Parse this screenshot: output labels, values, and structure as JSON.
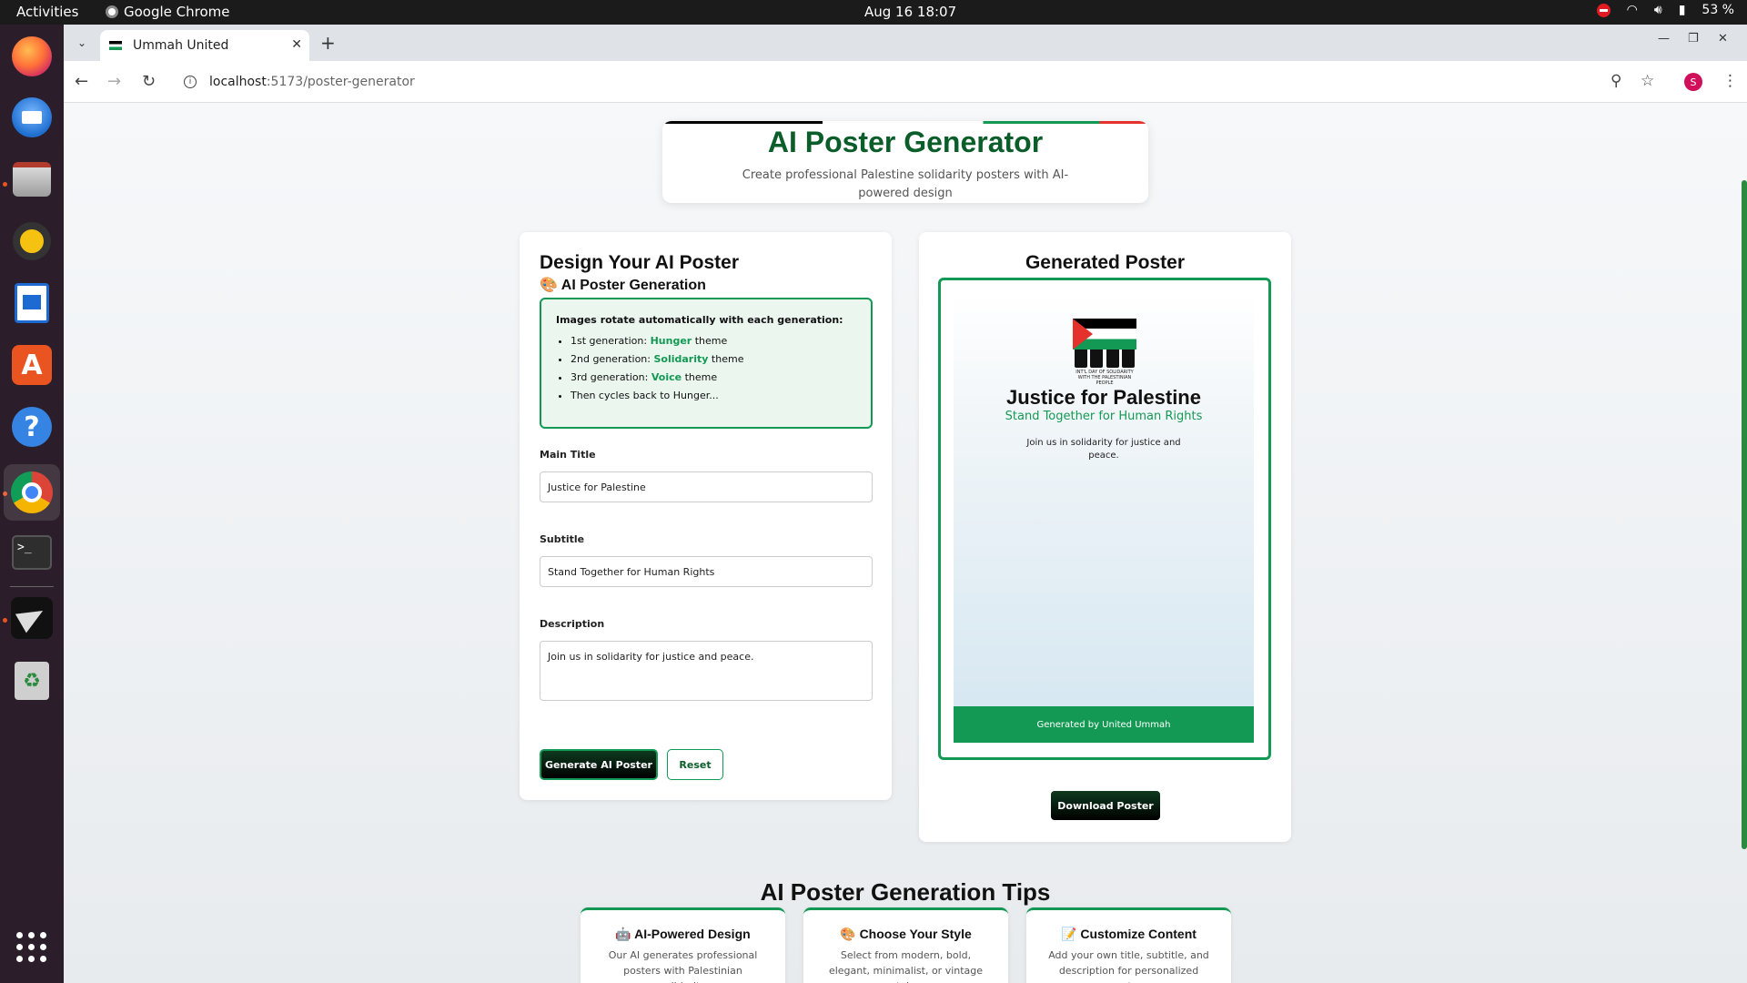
{
  "topbar": {
    "activities": "Activities",
    "app_name": "Google Chrome",
    "clock": "Aug 16  18:07",
    "battery": "53 %"
  },
  "dock": {
    "items": [
      "firefox",
      "thunderbird",
      "files",
      "rhythmbox",
      "libreoffice-writer",
      "app-center",
      "help",
      "google-chrome",
      "terminal",
      "deploy-tool",
      "trash",
      "show-apps"
    ]
  },
  "browser": {
    "tab_title": "Ummah United",
    "url_host": "localhost",
    "url_path": ":5173/poster-generator"
  },
  "header": {
    "title": "AI Poster Generator",
    "subtitle": "Create professional Palestine solidarity posters with AI-powered design"
  },
  "form": {
    "heading": "Design Your AI Poster",
    "subheading": "🎨 AI Poster Generation",
    "info_title": "Images rotate automatically with each generation:",
    "rotation": [
      {
        "prefix": "1st generation: ",
        "theme": "Hunger",
        "suffix": " theme"
      },
      {
        "prefix": "2nd generation: ",
        "theme": "Solidarity",
        "suffix": " theme"
      },
      {
        "prefix": "3rd generation: ",
        "theme": "Voice",
        "suffix": " theme"
      }
    ],
    "rotation_end": "Then cycles back to Hunger...",
    "main_title_label": "Main Title",
    "main_title_value": "Justice for Palestine",
    "subtitle_label": "Subtitle",
    "subtitle_value": "Stand Together for Human Rights",
    "description_label": "Description",
    "description_value": "Join us in solidarity for justice and peace.",
    "generate_button": "Generate AI Poster",
    "reset_button": "Reset"
  },
  "poster": {
    "heading": "Generated Poster",
    "image_caption": "INT'L DAY OF SOLIDARITY WITH THE PALESTINIAN PEOPLE",
    "title": "Justice for Palestine",
    "subtitle": "Stand Together for Human Rights",
    "description": "Join us in solidarity for justice and peace.",
    "footer": "Generated by United Ummah",
    "download_button": "Download Poster"
  },
  "tips": {
    "title": "AI Poster Generation Tips",
    "cards": [
      {
        "heading": "🤖 AI-Powered Design",
        "text": "Our AI generates professional posters with Palestinian solidarity"
      },
      {
        "heading": "🎨 Choose Your Style",
        "text": "Select from modern, bold, elegant, minimalist, or vintage styles"
      },
      {
        "heading": "📝 Customize Content",
        "text": "Add your own title, subtitle, and description for personalized posters"
      }
    ]
  },
  "colors": {
    "accent_green": "#149954",
    "dark_green": "#0b5d2a",
    "flag_red": "#e4312b"
  }
}
